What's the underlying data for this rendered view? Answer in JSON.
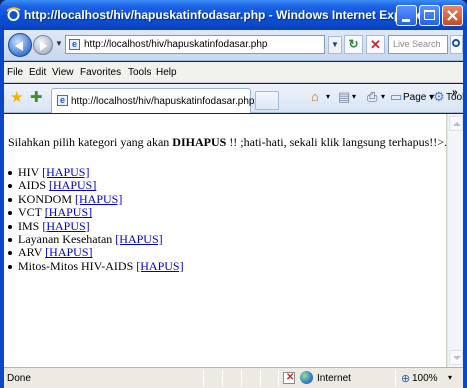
{
  "window": {
    "title": "http://localhost/hiv/hapuskatinfodasar.php - Windows Internet Explorer"
  },
  "address": {
    "url": "http://localhost/hiv/hapuskatinfodasar.php",
    "page_icon": "ie-page-icon"
  },
  "search": {
    "placeholder": "Live Search"
  },
  "menu": [
    "File",
    "Edit",
    "View",
    "Favorites",
    "Tools",
    "Help"
  ],
  "tab": {
    "label": "http://localhost/hiv/hapuskatinfodasar.php"
  },
  "commands": {
    "page": "Page",
    "tools": "Tools"
  },
  "content": {
    "intro_prefix": "Silahkan pilih kategori yang akan ",
    "intro_bold": "DIHAPUS",
    "intro_suffix": " !! ;hati-hati, sekali klik langsung terhapus!!>.",
    "delete_link_label": "[HAPUS]",
    "categories": [
      "HIV",
      "AIDS",
      "KONDOM",
      "VCT",
      "IMS",
      "Layanan Kesehatan",
      "ARV",
      "Mitos-Mitos HIV-AIDS"
    ]
  },
  "status": {
    "text": "Done",
    "zone": "Internet",
    "zoom": "100%"
  },
  "colors": {
    "link": "#0000cc",
    "titlebar": "#0a50d8"
  }
}
